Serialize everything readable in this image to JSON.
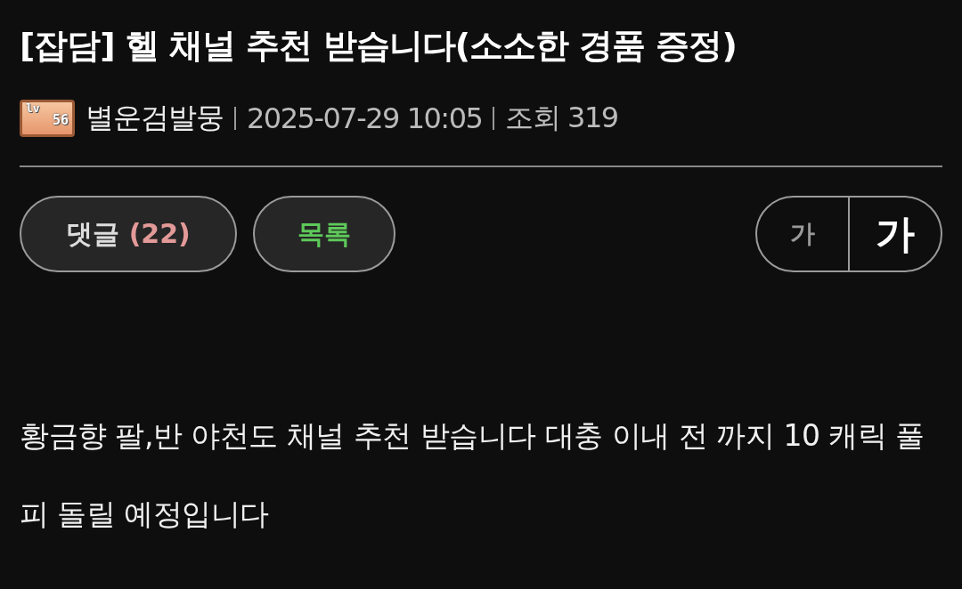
{
  "post": {
    "title": "[잡담] 헬 채널 추천 받습니다(소소한 경품 증정)",
    "author": {
      "level_badge": {
        "prefix": "lv",
        "level": "56"
      },
      "name": "별운검발뭉"
    },
    "date": "2025-07-29 10:05",
    "views": {
      "label": "조회",
      "count": "319"
    },
    "body": "황금향 팔,반 야천도 채널 추천 받습니다 대충 이내 전 까지 10 캐릭 풀피 돌릴 예정입니다"
  },
  "buttons": [
    {
      "kind": "comments",
      "label": "댓글",
      "count": "(22)"
    },
    {
      "kind": "list",
      "label": "목록"
    }
  ],
  "font_size_toggle": [
    {
      "label": "가",
      "selected": false
    },
    {
      "label": "가",
      "selected": true
    }
  ]
}
